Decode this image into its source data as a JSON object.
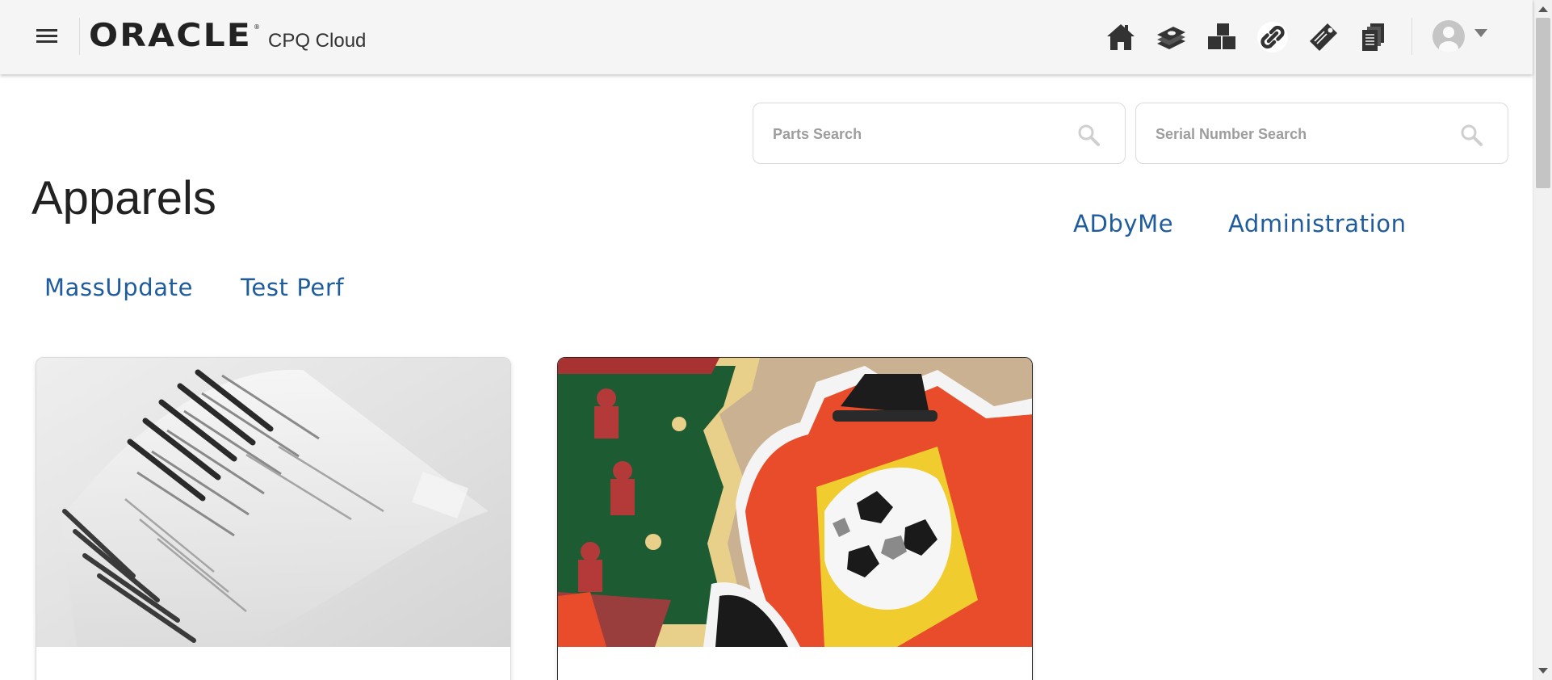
{
  "header": {
    "logo_text": "ORACLE",
    "app_name": "CPQ Cloud",
    "icons": [
      "home-icon",
      "quotes-icon",
      "products-icon",
      "link-icon",
      "tag-icon",
      "documents-icon"
    ],
    "menu_icon": "hamburger-menu-icon",
    "user_menu": "user-avatar"
  },
  "search": {
    "parts_placeholder": "Parts Search",
    "serial_placeholder": "Serial Number Search"
  },
  "page": {
    "title": "Apparels"
  },
  "links": {
    "right": [
      "ADbyMe",
      "Administration"
    ],
    "left": [
      "MassUpdate",
      "Test Perf"
    ]
  },
  "cards": [
    {
      "image": "rfid-tags-image"
    },
    {
      "image": "embroidered-patches-image"
    }
  ],
  "colors": {
    "header_bg": "#f5f5f5",
    "link": "#1f5c9e",
    "icon": "#333333"
  }
}
